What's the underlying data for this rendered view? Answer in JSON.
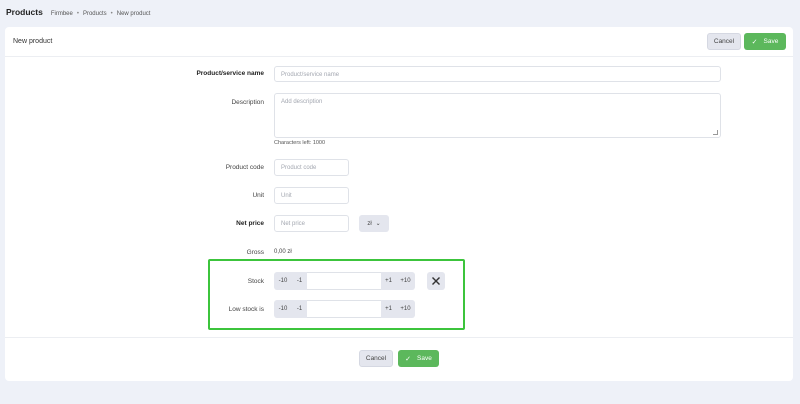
{
  "header": {
    "title": "Products",
    "breadcrumb": [
      "Firmbee",
      "Products",
      "New product"
    ]
  },
  "card": {
    "title": "New product",
    "cancel_label": "Cancel",
    "save_label": "Save"
  },
  "form": {
    "name": {
      "label": "Product/service name",
      "placeholder": "Product/service name"
    },
    "description": {
      "label": "Description",
      "placeholder": "Add description",
      "chars_left": "Characters left: 1000"
    },
    "code": {
      "label": "Product code",
      "placeholder": "Product code"
    },
    "unit": {
      "label": "Unit",
      "placeholder": "Unit"
    },
    "net_price": {
      "label": "Net price",
      "placeholder": "Net price",
      "currency": "zł"
    },
    "gross": {
      "label": "Gross",
      "value": "0,00 zł"
    },
    "stock": {
      "label": "Stock",
      "minus10": "-10",
      "minus1": "-1",
      "plus1": "+1",
      "plus10": "+10",
      "value": ""
    },
    "low_stock": {
      "label": "Low stock is",
      "minus10": "-10",
      "minus1": "-1",
      "plus1": "+1",
      "plus10": "+10",
      "value": ""
    }
  },
  "footer": {
    "cancel_label": "Cancel",
    "save_label": "Save"
  },
  "colors": {
    "accent": "#5cb85c",
    "highlight": "#3cc43c",
    "background": "#eef1f8"
  }
}
